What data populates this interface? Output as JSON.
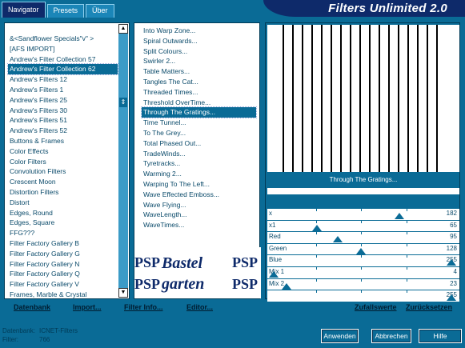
{
  "tabs": [
    "Navigator",
    "Presets",
    "Über"
  ],
  "app_title": "Filters Unlimited 2.0",
  "categories": [
    "&<Sandflower Specials\"v\" >",
    "[AFS IMPORT]",
    "Andrew's Filter Collection 57",
    "Andrew's Filter Collection 62",
    "Andrew's Filters 12",
    "Andrew's Filters 1",
    "Andrew's Filters 25",
    "Andrew's Filters 30",
    "Andrew's Filters 51",
    "Andrew's Filters 52",
    "Buttons & Frames",
    "Color Effects",
    "Color Filters",
    "Convolution Filters",
    "Crescent Moon",
    "Distortion Filters",
    "Distort",
    "Edges, Round",
    "Edges, Square",
    "FFG???",
    "Filter Factory Gallery B",
    "Filter Factory Gallery G",
    "Filter Factory Gallery N",
    "Filter Factory Gallery Q",
    "Filter Factory Gallery V",
    "Frames, Marble & Crystal"
  ],
  "selected_category": 3,
  "filters": [
    "Into Warp Zone...",
    "Spiral Outwards...",
    "Split Colours...",
    "Swirler 2...",
    "Table Matters...",
    "Tangles The Cat...",
    "Threaded Times...",
    "Threshold OverTime...",
    "Through The Gratings...",
    "Time Tunnel...",
    "To The Grey...",
    "Total Phased Out...",
    "TradeWinds...",
    "Tyretracks...",
    "Warming 2...",
    "Warping To The Left...",
    "Wave Effected Emboss...",
    "Wave Flying...",
    "WaveLength...",
    "WaveTimes..."
  ],
  "selected_filter": 8,
  "logo_text": [
    "Bastel",
    "garten"
  ],
  "preview_label": "Through The Gratings...",
  "sliders": [
    {
      "label": "x",
      "value": "182",
      "fraction": 0.714
    },
    {
      "label": "x1",
      "value": "65",
      "fraction": 0.255
    },
    {
      "label": "Red",
      "value": "95",
      "fraction": 0.373
    },
    {
      "label": "Green",
      "value": "128",
      "fraction": 0.502
    },
    {
      "label": "Blue",
      "value": "255",
      "fraction": 1.0
    },
    {
      "label": "Mix 1",
      "value": "4",
      "fraction": 0.016
    },
    {
      "label": "Mix 2",
      "value": "23",
      "fraction": 0.09
    },
    {
      "label": "",
      "value": "255",
      "fraction": 1.0
    }
  ],
  "menu": {
    "datenbank": "Datenbank",
    "import": "Import...",
    "filter_info": "Filter Info...",
    "editor": "Editor...",
    "zufallswerte": "Zufallswerte",
    "zuruecksetzen": "Zurücksetzen"
  },
  "status": {
    "db_label": "Datenbank:",
    "db_value": "ICNET-Filters",
    "filter_label": "Filter:",
    "filter_value": "766"
  },
  "buttons": {
    "apply": "Anwenden",
    "cancel": "Abbrechen",
    "help": "Hilfe"
  },
  "colors": {
    "background": "#0a6b96",
    "title_banner": "#0e2a6a",
    "selection": "#0a6b96"
  }
}
